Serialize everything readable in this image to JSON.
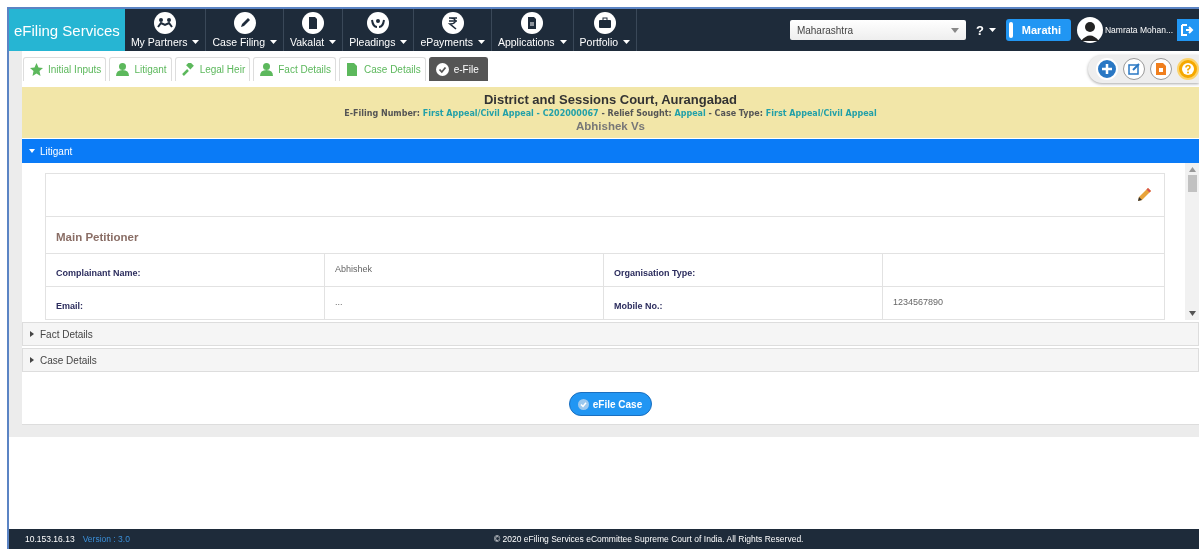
{
  "navbar": {
    "brand": "eFiling Services",
    "menu": [
      {
        "label": "My Partners"
      },
      {
        "label": "Case Filing"
      },
      {
        "label": "Vakalat"
      },
      {
        "label": "Pleadings"
      },
      {
        "label": "ePayments"
      },
      {
        "label": "Applications"
      },
      {
        "label": "Portfolio"
      }
    ],
    "state_select": {
      "value": "Maharashtra"
    },
    "help": "?",
    "language_toggle": {
      "label": "Marathi",
      "on": false
    },
    "user_name": "Namrata Mohan..."
  },
  "tabs": [
    {
      "label": "Initial Inputs",
      "selected": false
    },
    {
      "label": "Litigant",
      "selected": false
    },
    {
      "label": "Legal Heir",
      "selected": false
    },
    {
      "label": "Fact Details",
      "selected": false
    },
    {
      "label": "Case Details",
      "selected": false
    },
    {
      "label": "e-File",
      "selected": true
    }
  ],
  "case_header": {
    "court": "District and Sessions Court, Aurangabad",
    "details": [
      {
        "kind": "label",
        "text": "E-Filing Number:"
      },
      {
        "kind": "value",
        "text": "First Appeal/Civil Appeal - C202000067"
      },
      {
        "kind": "label",
        "text": "- Relief Sought:"
      },
      {
        "kind": "value",
        "text": "Appeal"
      },
      {
        "kind": "label",
        "text": "- Case Type:"
      },
      {
        "kind": "value",
        "text": "First Appeal/Civil Appeal"
      }
    ],
    "parties": "Abhishek Vs"
  },
  "sections": [
    {
      "title": "Litigant",
      "expanded": true,
      "content": {
        "heading": "Main Petitioner",
        "rows": [
          {
            "label_1": "Complainant Name:",
            "value_1": "Abhishek",
            "label_2": "Organisation Type:"
          },
          {
            "label_1": "Email:",
            "value_1": "...",
            "label_2": "Mobile No.:",
            "value_2": "1234567890"
          },
          {}
        ]
      }
    },
    {
      "title": "Fact Details",
      "expanded": false
    },
    {
      "title": "Case Details",
      "expanded": false
    }
  ],
  "submit_button": "eFile Case",
  "footer": {
    "ip": "10.153.16.13",
    "version": "Version : 3.0",
    "copyright": "© 2020 eFiling Services eCommittee Supreme Court of India. All Rights Reserved."
  }
}
